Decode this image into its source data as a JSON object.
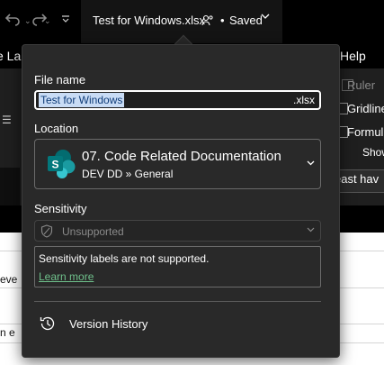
{
  "titlebar": {
    "undo_icon": "undo-icon",
    "redo_icon": "redo-icon",
    "file_title": "Test for Windows.xlsx",
    "separator": "•",
    "save_status": "Saved",
    "chevron": "⌄"
  },
  "menubar": {
    "left_fragment": "e La",
    "help": "Help"
  },
  "ribbon": {
    "ruler": "Ruler",
    "gridlines": "Gridline",
    "formula": "Formula",
    "show": "Show"
  },
  "infobar": {
    "fragment": "east hav"
  },
  "sheet": {
    "row1": "eve",
    "row2": "n e"
  },
  "popup": {
    "file_name_label": "File name",
    "file_name_value": "Test for Windows",
    "file_ext": ".xlsx",
    "location_label": "Location",
    "location_name": "07. Code Related Documentation",
    "location_path": "DEV DD » General",
    "sensitivity_label": "Sensitivity",
    "sensitivity_value": "Unsupported",
    "sensitivity_message": "Sensitivity labels are not supported.",
    "learn_more": "Learn more",
    "version_history": "Version History"
  },
  "colors": {
    "popup_bg": "#292929",
    "link_green": "#6fc08b",
    "selection": "#c9dcf5",
    "sharepoint_teal": "#0f7b77"
  }
}
